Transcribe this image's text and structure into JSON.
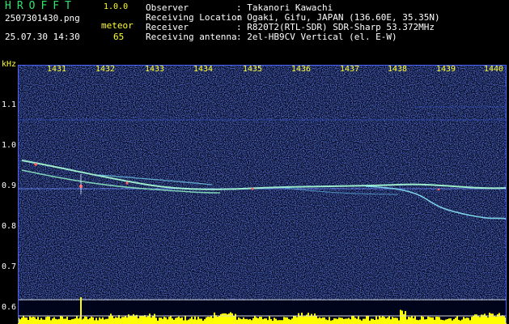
{
  "app": {
    "logo": "HROFFT",
    "version": "1.0.0"
  },
  "file": {
    "name": "2507301430.png",
    "datetime": "25.07.30 14:30"
  },
  "meteor": {
    "label": "meteor",
    "count": "65"
  },
  "info": [
    {
      "key": "Observer",
      "value": ": Takanori Kawachi"
    },
    {
      "key": "Receiving Location",
      "value": ": Ogaki, Gifu, JAPAN (136.60E, 35.35N)"
    },
    {
      "key": "Receiver",
      "value": ": R820T2(RTL-SDR) SDR-Sharp 53.372MHz"
    },
    {
      "key": "Receiving antenna",
      "value": ": 2el-HB9CV Vertical (el. E-W)"
    }
  ],
  "axis": {
    "unit": "kHz",
    "x_ticks": [
      "1431",
      "1432",
      "1433",
      "1434",
      "1435",
      "1436",
      "1437",
      "1438",
      "1439",
      "1440"
    ],
    "y_ticks": [
      "1.1",
      "1.0",
      "0.9",
      "0.8",
      "0.7",
      "0.6"
    ]
  },
  "colors": {
    "background": "#000000",
    "noise": "#2a3cff",
    "label_yellow": "#ffff33",
    "logo_green": "#2ee66a",
    "trace": "#a8ffd8",
    "spectrum": "#ffff00"
  }
}
